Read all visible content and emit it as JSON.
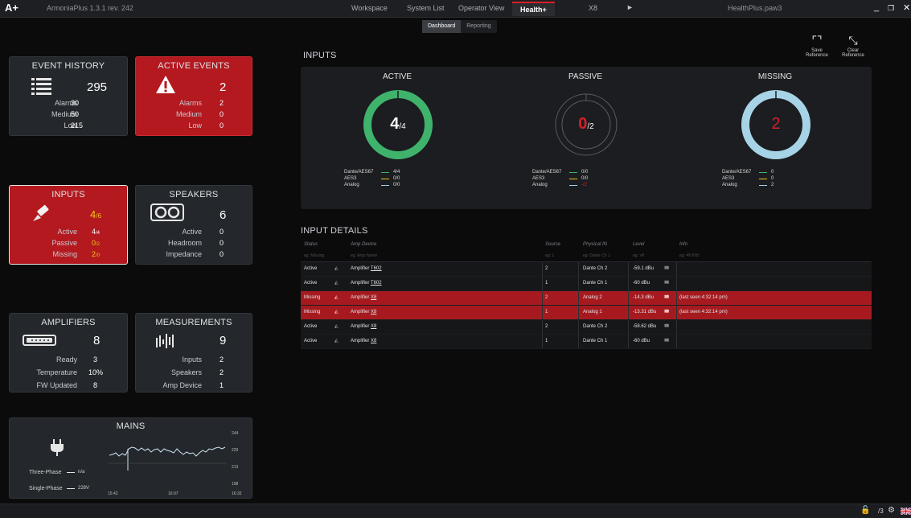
{
  "titlebar": {
    "logo": "A+",
    "app_title": "ArmoniaPlus 1.3.1 rev. 242",
    "tabs": [
      "Workspace",
      "System List",
      "Operator View",
      "Health+",
      "X8"
    ],
    "active_tab": "Health+",
    "play_label": "►",
    "filename": "HealthPlus.paw3",
    "minimize": "_",
    "restore": "❐",
    "close": "✕"
  },
  "subtabs": [
    "Dashboard",
    "Reporting"
  ],
  "tiles": {
    "event_history": {
      "title": "EVENT HISTORY",
      "count": "295",
      "rows": [
        [
          "Alarms",
          "30"
        ],
        [
          "Medium",
          "50"
        ],
        [
          "Low",
          "215"
        ]
      ]
    },
    "active_events": {
      "title": "ACTIVE EVENTS",
      "count": "2",
      "rows": [
        [
          "Alarms",
          "2"
        ],
        [
          "Medium",
          "0"
        ],
        [
          "Low",
          "0"
        ]
      ]
    },
    "inputs": {
      "title": "INPUTS",
      "count_main": "4",
      "count_sub": "/6",
      "rows": [
        [
          "Active",
          "4",
          "/4"
        ],
        [
          "Passive",
          "0",
          "/2"
        ],
        [
          "Missing",
          "2",
          "/0"
        ]
      ]
    },
    "speakers": {
      "title": "SPEAKERS",
      "count": "6",
      "rows": [
        [
          "Active",
          "0"
        ],
        [
          "Headroom",
          "0"
        ],
        [
          "Impedance",
          "0"
        ]
      ]
    },
    "amplifiers": {
      "title": "AMPLIFIERS",
      "count": "8",
      "rows": [
        [
          "Ready",
          "3"
        ],
        [
          "Temperature",
          "10%"
        ],
        [
          "FW Updated",
          "8"
        ]
      ]
    },
    "measurements": {
      "title": "MEASUREMENTS",
      "count": "9",
      "rows": [
        [
          "Inputs",
          "2"
        ],
        [
          "Speakers",
          "2"
        ],
        [
          "Amp Device",
          "1"
        ]
      ]
    },
    "mains": {
      "title": "MAINS",
      "three_phase_label": "Three-Phase",
      "three_phase_value": "n/a",
      "single_phase_label": "Single-Phase",
      "single_phase_value": "228V",
      "y_ticks": [
        "244",
        "229",
        "213",
        "198"
      ],
      "x_ticks": [
        "15:42",
        "16:07",
        "16:32"
      ]
    }
  },
  "inputs_section": {
    "label": "INPUTS",
    "save_reference": "Save\nReference",
    "clear_reference": "Clear\nReference",
    "blocks": [
      {
        "title": "ACTIVE",
        "value_main": "4",
        "value_sub": "/4",
        "color": "#3fb36b",
        "fill": 1.0,
        "legend": [
          [
            "Dante/AES67",
            "4/4"
          ],
          [
            "AES3",
            "0/0"
          ],
          [
            "Analog",
            "0/0"
          ]
        ]
      },
      {
        "title": "PASSIVE",
        "value_main": "0",
        "value_sub": "/2",
        "color": "#3a3d42",
        "fill": 0.0,
        "legend": [
          [
            "Dante/AES67",
            "0/0"
          ],
          [
            "AES3",
            "0/0"
          ],
          [
            "Analog",
            "-/2"
          ]
        ]
      },
      {
        "title": "MISSING",
        "value_main": "2",
        "value_sub": "",
        "color": "#a6d3e6",
        "fill": 1.0,
        "legend": [
          [
            "Dante/AES67",
            "0"
          ],
          [
            "AES3",
            "0"
          ],
          [
            "Analog",
            "2"
          ]
        ]
      }
    ]
  },
  "input_details": {
    "label": "INPUT DETAILS",
    "columns": [
      "Status",
      "Amp Device",
      "Source",
      "Physical IN",
      "Level",
      "Info"
    ],
    "filters": [
      "eg: Missing",
      "eg: Amp Name",
      "eg: 1",
      "eg: Dante Ch 1",
      "eg: >8",
      "eg: 48 KHz"
    ],
    "rows": [
      {
        "status": "Active",
        "device": "Amplifier T602",
        "source": "2",
        "physical": "Dante Ch 2",
        "level": "-59.1 dBu",
        "info": "",
        "missing": false
      },
      {
        "status": "Active",
        "device": "Amplifier T602",
        "source": "1",
        "physical": "Dante Ch 1",
        "level": "-60 dBu",
        "info": "",
        "missing": false
      },
      {
        "status": "Missing",
        "device": "Amplifier X8",
        "source": "2",
        "physical": "Analog 2",
        "level": "-14.3 dBu",
        "info": "(last seen 4:32:14 pm)",
        "missing": true
      },
      {
        "status": "Missing",
        "device": "Amplifier X8",
        "source": "1",
        "physical": "Analog 1",
        "level": "-13.31 dBu",
        "info": "(last seen 4:32:14 pm)",
        "missing": true
      },
      {
        "status": "Active",
        "device": "Amplifier X8",
        "source": "2",
        "physical": "Dante Ch 2",
        "level": "-58.62 dBu",
        "info": "",
        "missing": false
      },
      {
        "status": "Active",
        "device": "Amplifier X8",
        "source": "1",
        "physical": "Dante Ch 1",
        "level": "-60 dBu",
        "info": "",
        "missing": false
      }
    ]
  },
  "bottombar": {
    "lock_icon": "unlock-icon",
    "version": "/3",
    "settings_icon": "gear-icon",
    "flag_icon": "uk-flag-icon"
  },
  "colors": {
    "accent_red": "#b3191f",
    "active_green": "#3fb36b",
    "missing_blue": "#a6d3e6",
    "warn_yellow": "#f2c418"
  }
}
